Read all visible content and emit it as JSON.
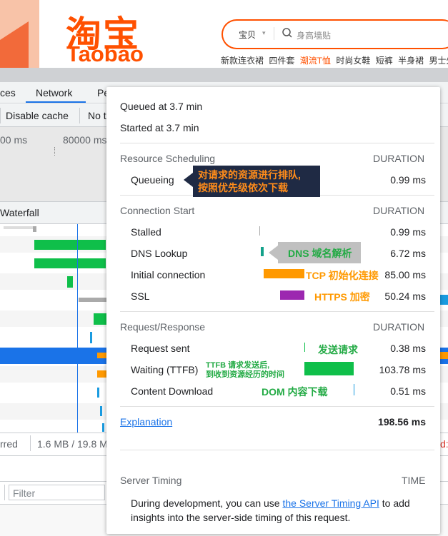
{
  "taobao": {
    "logo_cn": "淘宝",
    "logo_en": "Taobao",
    "search_category": "宝贝",
    "search_placeholder": "身高墙贴",
    "hot_tags": [
      "新款连衣裙",
      "四件套",
      "潮流T恤",
      "时尚女鞋",
      "短裤",
      "半身裙",
      "男士外套"
    ],
    "brand_color": "#ff5000"
  },
  "devtools": {
    "tabs": [
      "ces",
      "Network",
      "Pe"
    ],
    "toolbar": {
      "disable_cache": "Disable cache",
      "throttle": "No t"
    },
    "ticks": [
      "00 ms",
      "80000 ms"
    ],
    "waterfall_label": "Waterfall",
    "status": {
      "transferred": "rred",
      "size": "1.6 MB / 19.8 M",
      "extra": "d:"
    },
    "filter_placeholder": "Filter"
  },
  "timing": {
    "queued_at": "Queued at 3.7 min",
    "started_at": "Started at 3.7 min",
    "duration_header": "DURATION",
    "sections": [
      {
        "title": "Resource Scheduling",
        "rows": [
          {
            "label": "Queueing",
            "value": "0.99 ms"
          }
        ]
      },
      {
        "title": "Connection Start",
        "rows": [
          {
            "label": "Stalled",
            "value": "0.99 ms"
          },
          {
            "label": "DNS Lookup",
            "value": "6.72 ms"
          },
          {
            "label": "Initial connection",
            "value": "85.00 ms"
          },
          {
            "label": "SSL",
            "value": "50.24 ms"
          }
        ]
      },
      {
        "title": "Request/Response",
        "rows": [
          {
            "label": "Request sent",
            "value": "0.38 ms"
          },
          {
            "label": "Waiting (TTFB)",
            "value": "103.78 ms"
          },
          {
            "label": "Content Download",
            "value": "0.51 ms"
          }
        ]
      }
    ],
    "explanation": "Explanation",
    "total": "198.56 ms",
    "server_timing": {
      "title": "Server Timing",
      "time_header": "TIME",
      "desc_before": "During development, you can use ",
      "link": "the Server Timing API",
      "desc_after": " to add insights into the server-side timing of this request."
    }
  },
  "annotations": {
    "queueing": [
      "对请求的资源进行排队,",
      "按照优先级依次下载"
    ],
    "dns": "DNS 域名解析",
    "tcp": "TCP 初始化连接",
    "https": "HTTPS 加密",
    "send": "发送请求",
    "ttfb": [
      "TTFB 请求发送后,",
      "到收到资源经历的时间"
    ],
    "dom": "DOM 内容下载"
  },
  "colors": {
    "dns_bar": "#13a18a",
    "tcp_bar": "#ff9900",
    "ssl_bar": "#9c27b0",
    "ttfb_bar": "#0fbf4a",
    "download_bar": "#1a9be0",
    "selected_row": "#1a73e8"
  }
}
